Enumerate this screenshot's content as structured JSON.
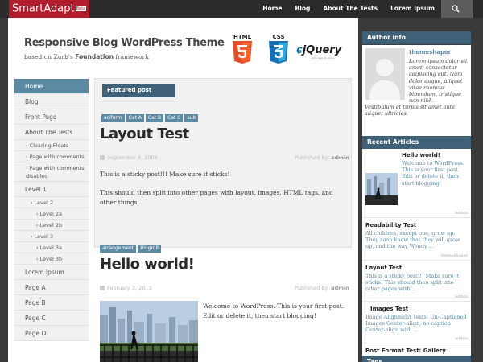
{
  "topbar": {
    "logo": "SmartAdapt",
    "logo_badge": "Beta",
    "nav": [
      "Home",
      "Blog",
      "About The Tests",
      "Lorem Ipsum"
    ],
    "search_icon": "search-icon"
  },
  "header": {
    "title": "Responsive Blog WordPress Theme",
    "tagline_pre": "based on Zurb's ",
    "tagline_bold": "Foundation",
    "tagline_post": " framework",
    "html5_label": "HTML",
    "css3_label": "CSS",
    "jquery_label": "jQuery",
    "jquery_sub": "write less, do more."
  },
  "sidenav": [
    {
      "label": "Home",
      "level": 1,
      "active": true
    },
    {
      "label": "Blog",
      "level": 1
    },
    {
      "label": "Front Page",
      "level": 1
    },
    {
      "label": "About The Tests",
      "level": 1
    },
    {
      "label": "Clearing Floats",
      "level": 2
    },
    {
      "label": "Page with comments",
      "level": 2
    },
    {
      "label": "Page with comments disabled",
      "level": 2,
      "wrap": true
    },
    {
      "label": "Level 1",
      "level": 1
    },
    {
      "label": "Level 2",
      "level": 3
    },
    {
      "label": "Level 2a",
      "level": 4
    },
    {
      "label": "Level 2b",
      "level": 4
    },
    {
      "label": "Level 3",
      "level": 3
    },
    {
      "label": "Level 3a",
      "level": 4
    },
    {
      "label": "Level 3b",
      "level": 4
    },
    {
      "label": "Lorem Ipsum",
      "level": 1
    },
    {
      "label": "Page A",
      "level": 1
    },
    {
      "label": "Page B",
      "level": 1
    },
    {
      "label": "Page C",
      "level": 1
    },
    {
      "label": "Page D",
      "level": 1
    }
  ],
  "featured": {
    "heading": "Featured post",
    "tags": [
      "aciform",
      "Cat A",
      "Cat B",
      "Cat C",
      "sub"
    ],
    "title": "Layout Test",
    "date": "September 4, 2008",
    "by": "Published by: ",
    "author": "admin",
    "p1": "This is a sticky post!!! Make sure it sticks!",
    "p2": "This should then split into other pages with layout, images, HTML tags, and other things."
  },
  "post2": {
    "tags": [
      "arrangement",
      "Blogroll"
    ],
    "title": "Hello world!",
    "date": "February 3, 2013",
    "by": "Published by: ",
    "author": "admin",
    "p1": "Welcome to WordPress. This is your first post. Edit or delete it, then start blogging!"
  },
  "author_widget": {
    "heading": "Author info",
    "name": "themeshaper",
    "bio": "Lorem ipsum dolor sit amet, consectetur adipiscing elit. Nam dolor augue, aliquet vitae rhoncus bibendum, tristique non nibh.",
    "bio2": "Vestibulum et turpis sit amet ante aliquet ultricies."
  },
  "recent_widget": {
    "heading": "Recent Articles",
    "items": [
      {
        "title": "Hello world!",
        "excerpt": "Welcome to WordPress. This is your first post. Edit or delete it, then start blogging!",
        "author": "admin"
      },
      {
        "title": "Readability Test",
        "excerpt": "All children, except one, grow up. They soon know that they will grow up, and the way Wendy ...",
        "author": "themeshaper"
      },
      {
        "title": "Layout Test",
        "excerpt": "This is a sticky post!!! Make sure it sticks! This should then split into other pages with ...",
        "author": "admin"
      },
      {
        "title": "Images Test",
        "excerpt": "Image Alignment Tests: Un-Captioned Images Center-align, no caption Center-align with ...",
        "author": "admin"
      },
      {
        "title": "Post Format Test: Gallery",
        "excerpt": "",
        "author": ""
      }
    ]
  },
  "tags_widget": {
    "heading": "Tags"
  }
}
